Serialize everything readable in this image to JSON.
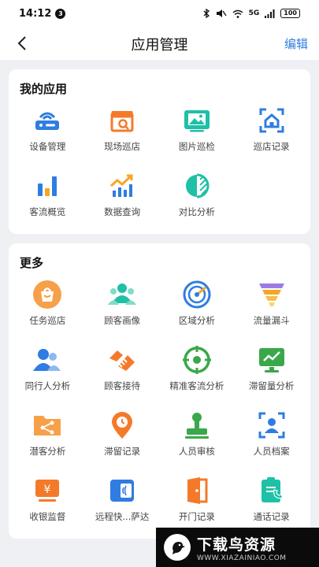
{
  "status_bar": {
    "time": "14:12",
    "notification_count": "3",
    "network": "5G",
    "battery": "100"
  },
  "nav": {
    "title": "应用管理",
    "edit_label": "编辑"
  },
  "my_apps": {
    "title": "我的应用",
    "items": [
      {
        "label": "设备管理",
        "icon": "router-icon"
      },
      {
        "label": "现场巡店",
        "icon": "store-search-icon"
      },
      {
        "label": "图片巡检",
        "icon": "image-gallery-icon"
      },
      {
        "label": "巡店记录",
        "icon": "house-scan-icon"
      },
      {
        "label": "客流概览",
        "icon": "bar-chart-icon"
      },
      {
        "label": "数据查询",
        "icon": "trend-chart-icon"
      },
      {
        "label": "对比分析",
        "icon": "compare-circle-icon"
      }
    ]
  },
  "more": {
    "title": "更多",
    "items": [
      {
        "label": "任务巡店",
        "icon": "task-bag-icon"
      },
      {
        "label": "顾客画像",
        "icon": "customers-icon"
      },
      {
        "label": "区域分析",
        "icon": "radar-icon"
      },
      {
        "label": "流量漏斗",
        "icon": "funnel-icon"
      },
      {
        "label": "同行人分析",
        "icon": "companions-icon"
      },
      {
        "label": "顾客接待",
        "icon": "handshake-icon"
      },
      {
        "label": "精准客流分析",
        "icon": "target-icon"
      },
      {
        "label": "滞留量分析",
        "icon": "monitor-chart-icon"
      },
      {
        "label": "潜客分析",
        "icon": "share-folder-icon"
      },
      {
        "label": "滞留记录",
        "icon": "location-clock-icon"
      },
      {
        "label": "人员审核",
        "icon": "stamp-icon"
      },
      {
        "label": "人员档案",
        "icon": "face-scan-icon"
      },
      {
        "label": "收银监督",
        "icon": "cashier-icon"
      },
      {
        "label": "远程快...萨达",
        "icon": "remote-card-icon"
      },
      {
        "label": "开门记录",
        "icon": "door-icon"
      },
      {
        "label": "通话记录",
        "icon": "call-log-icon"
      }
    ]
  },
  "watermark": {
    "title": "下载鸟资源",
    "url": "WWW.XIAZAINIAO.COM"
  },
  "colors": {
    "accent": "#2f7de1",
    "orange": "#f47a2a",
    "teal": "#1ec0a6",
    "green": "#3aa84a"
  }
}
